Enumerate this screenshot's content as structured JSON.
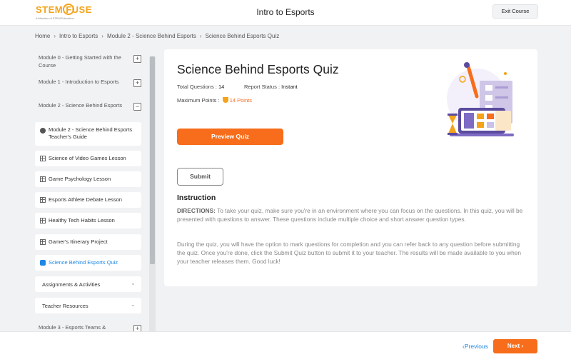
{
  "header": {
    "logo_text": "STEM FUSE",
    "logo_subtitle": "A Member of STEM Education",
    "title": "Intro to Esports",
    "exit_label": "Exit Course"
  },
  "breadcrumb": [
    "Home",
    "Intro to Esports",
    "Module 2 - Science Behind Esports",
    "Science Behind Esports Quiz"
  ],
  "sidebar": {
    "modules": [
      {
        "label": "Module 0 - Getting Started with the Course",
        "toggle": "+"
      },
      {
        "label": "Module 1 - Introduction to Esports",
        "toggle": "+"
      },
      {
        "label": "Module 2 - Science Behind Esports",
        "toggle": "−"
      },
      {
        "label": "Module 3 - Esports Teams &",
        "toggle": "+"
      }
    ],
    "lessons": [
      {
        "label": "Module 2 - Science Behind Esports Teacher's Guide",
        "icon": "gear-icon"
      },
      {
        "label": "Science of Video Games Lesson",
        "icon": "grid-icon"
      },
      {
        "label": "Game Psychology Lesson",
        "icon": "grid-icon"
      },
      {
        "label": "Esports Athlete Debate Lesson",
        "icon": "grid-icon"
      },
      {
        "label": "Healthy Tech Habits Lesson",
        "icon": "grid-icon"
      },
      {
        "label": "Gamer's Itinerary Project",
        "icon": "grid-icon"
      },
      {
        "label": "Science Behind Esports Quiz",
        "icon": "puzzle-icon",
        "active": true
      }
    ],
    "accordions": [
      {
        "label": "Assignments & Activities"
      },
      {
        "label": "Teacher Resources"
      }
    ]
  },
  "quiz": {
    "title": "Science Behind Esports Quiz",
    "total_questions_label": "Total Questions :",
    "total_questions_value": "14",
    "report_status_label": "Report Status :",
    "report_status_value": "Instant",
    "max_points_label": "Maximum Points :",
    "max_points_value": "14 Points",
    "preview_label": "Preview Quiz",
    "submit_label": "Submit",
    "instruction_title": "Instruction",
    "directions_label": "DIRECTIONS:",
    "paragraph1": "To take your quiz, make sure you're in an environment where you can focus on the questions. In this quiz, you will be presented with questions to answer. These questions include multiple choice and short answer question types.",
    "paragraph2": "During the quiz, you will have the option to mark questions for completion and you can refer back to any question before submitting the quiz. Once you're done, click the Submit Quiz button to submit it to your teacher. The results will be made available to you when your teacher releases them. Good luck!"
  },
  "footer": {
    "previous_label": "Previous",
    "next_label": "Next"
  },
  "colors": {
    "accent_orange": "#f76d1b",
    "link_blue": "#1e88e5",
    "logo_orange": "#f5a31a"
  }
}
